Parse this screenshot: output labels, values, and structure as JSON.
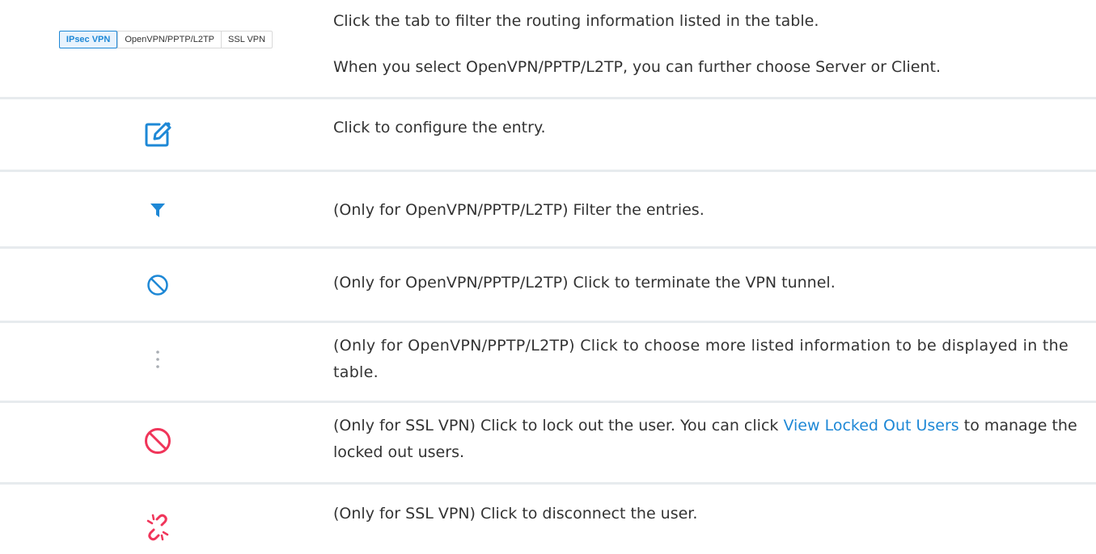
{
  "tabs": {
    "items": [
      "IPsec VPN",
      "OpenVPN/PPTP/L2TP",
      "SSL VPN"
    ],
    "active": "IPsec VPN"
  },
  "rows": [
    {
      "icon": "tab-group",
      "desc_line1": "Click the tab to filter the routing information listed in the table.",
      "desc_line2": "When you select OpenVPN/PPTP/L2TP, you can further choose Server or Client."
    },
    {
      "icon": "edit-icon",
      "desc": "Click to configure the entry."
    },
    {
      "icon": "filter-icon",
      "desc": "(Only for OpenVPN/PPTP/L2TP) Filter the entries."
    },
    {
      "icon": "terminate-icon",
      "desc": "(Only for OpenVPN/PPTP/L2TP) Click to terminate the VPN tunnel."
    },
    {
      "icon": "more-options-icon",
      "desc": "(Only for OpenVPN/PPTP/L2TP) Click to choose more listed information to be displayed in the table."
    },
    {
      "icon": "lockout-icon",
      "desc_before": "(Only for SSL VPN) Click to lock out the user. You can click ",
      "desc_link": "View Locked Out Users",
      "desc_after": " to manage the locked out users."
    },
    {
      "icon": "disconnect-icon",
      "desc": "(Only for SSL VPN) Click to disconnect the user."
    }
  ],
  "colors": {
    "accent_blue": "#1e88d6",
    "danger_red": "#f0355a",
    "divider": "#e7ebee",
    "text": "#333333"
  }
}
